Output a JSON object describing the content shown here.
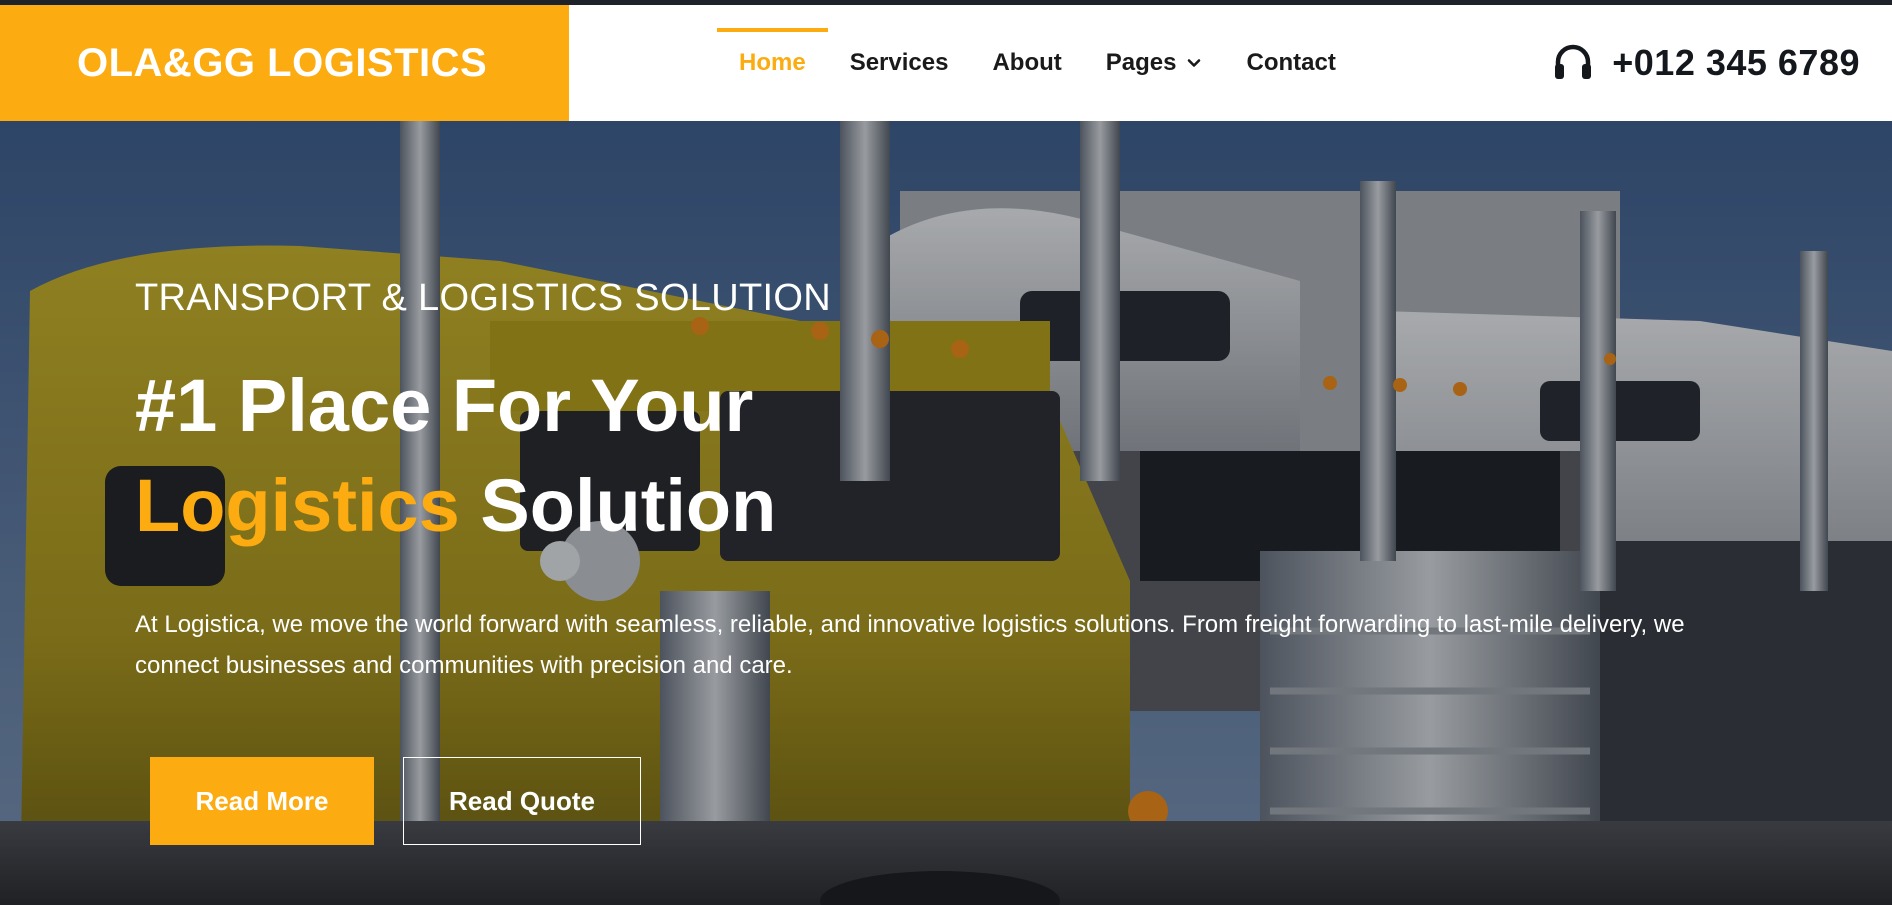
{
  "brand": {
    "name": "OLA&GG LOGISTICS",
    "color": "#fcab10"
  },
  "nav": {
    "items": [
      {
        "label": "Home",
        "active": true
      },
      {
        "label": "Services",
        "active": false
      },
      {
        "label": "About",
        "active": false
      },
      {
        "label": "Pages",
        "active": false,
        "has_dropdown": true
      },
      {
        "label": "Contact",
        "active": false
      }
    ],
    "dropdown_icon": "chevron-down-icon"
  },
  "contact": {
    "icon": "headphones-icon",
    "phone": "+012 345 6789"
  },
  "hero": {
    "background": "yellow and chrome trucks photo",
    "eyebrow": "TRANSPORT & LOGISTICS SOLUTION",
    "headline_line1": "#1 Place For Your",
    "headline_accent": "Logistics",
    "headline_rest": "Solution",
    "description": "At Logistica, we move the world forward with seamless, reliable, and innovative logistics solutions. From freight forwarding to last-mile delivery, we connect businesses and communities with precision and care.",
    "primary_button": "Read More",
    "secondary_button": "Read Quote"
  },
  "colors": {
    "accent": "#fcab10",
    "text_dark": "#1a1a1a",
    "white": "#ffffff"
  }
}
